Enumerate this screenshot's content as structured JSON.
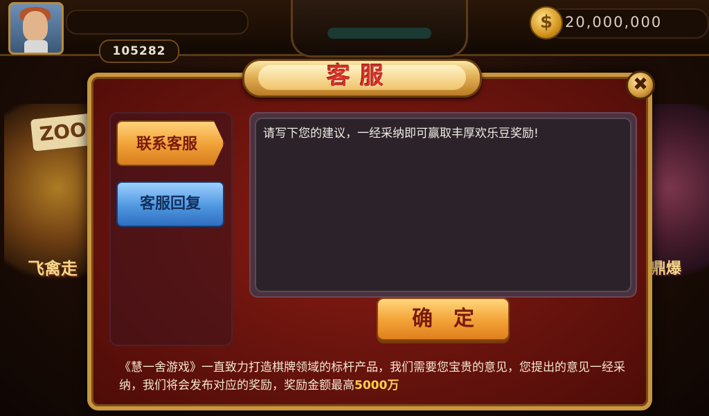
{
  "topbar": {
    "player_id": "105282",
    "gold_amount": "20,000,000",
    "coin_symbol": "$"
  },
  "background": {
    "left_banner": "ZOO",
    "left_banner_2": "飞禽走",
    "right_banner_2": "鼎爆"
  },
  "dialog": {
    "title": "客服",
    "close_symbol": "✖",
    "tabs": [
      {
        "label": "联系客服",
        "active": true
      },
      {
        "label": "客服回复",
        "active": false
      }
    ],
    "input_placeholder": "请写下您的建议，一经采纳即可赢取丰厚欢乐豆奖励!",
    "confirm_label": "确定",
    "footer_text": "《慧一舍游戏》一直致力打造棋牌领域的标杆产品，我们需要您宝贵的意见，您提出的意见一经采纳，我们将会发布对应的奖励，奖励金额最高",
    "footer_amount": "5000万"
  },
  "colors": {
    "dialog_bg": "#6b140e",
    "dialog_border": "#c9963e",
    "active_tab": "#f0a036",
    "inactive_tab": "#4f97e0",
    "highlight": "#ffd24a"
  }
}
